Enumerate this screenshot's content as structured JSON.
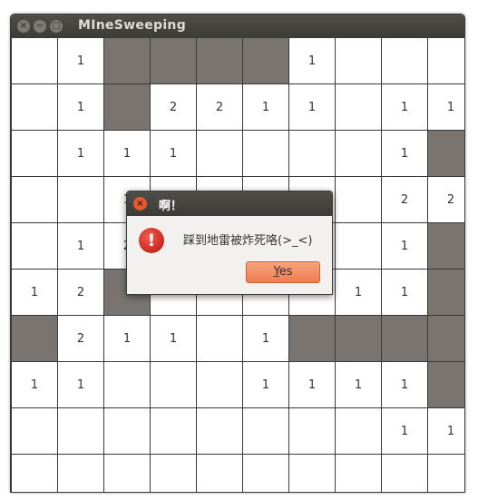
{
  "window": {
    "title": "MIneSweeping"
  },
  "board": {
    "rows": [
      [
        "",
        "1",
        "#",
        "#",
        "#",
        "#",
        "1",
        "",
        "",
        ""
      ],
      [
        "",
        "1",
        "#",
        "2",
        "2",
        "1",
        "1",
        "",
        "1",
        "1"
      ],
      [
        "",
        "1",
        "1",
        "1",
        "",
        "",
        "",
        "",
        "1",
        "#"
      ],
      [
        "",
        "",
        "1",
        "",
        "",
        "",
        "",
        "",
        "2",
        "2"
      ],
      [
        "",
        "1",
        "2",
        "",
        "",
        "",
        "",
        "",
        "1",
        "#"
      ],
      [
        "1",
        "2",
        "#",
        "",
        "",
        "",
        "",
        "1",
        "1",
        "#"
      ],
      [
        "#",
        "2",
        "1",
        "1",
        "",
        "1",
        "#",
        "#",
        "#",
        "#"
      ],
      [
        "1",
        "1",
        "",
        "",
        "",
        "1",
        "1",
        "1",
        "1",
        "#"
      ],
      [
        "",
        "",
        "",
        "",
        "",
        "",
        "",
        "",
        "1",
        "1"
      ],
      [
        "",
        "",
        "",
        "",
        "",
        "",
        "",
        "",
        "",
        ""
      ]
    ],
    "mine_color": "#7a7471"
  },
  "dialog": {
    "title": "啊！",
    "message": "踩到地雷被炸死咯(>_<)",
    "button_mnemonic": "Y",
    "button_rest": "es",
    "icon": "error-icon"
  }
}
